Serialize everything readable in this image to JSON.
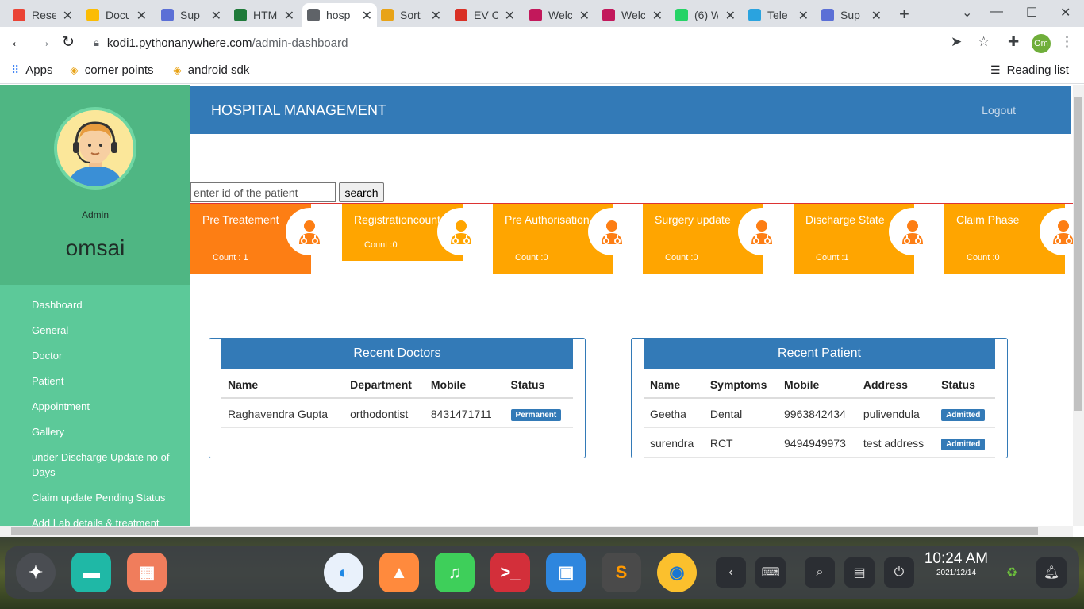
{
  "browser": {
    "tabs": [
      {
        "label": "Rese",
        "icon": "gmail-icon",
        "color": "#ea4335"
      },
      {
        "label": "Docu",
        "icon": "drive-icon",
        "color": "#fbbc04"
      },
      {
        "label": "Sup",
        "icon": "support-icon",
        "color": "#5b6fd6"
      },
      {
        "label": "HTM",
        "icon": "w-icon",
        "color": "#1f7a3a"
      },
      {
        "label": "hosp",
        "icon": "globe-icon",
        "color": "#5f6368"
      },
      {
        "label": "Sort",
        "icon": "sort-icon",
        "color": "#e8a317"
      },
      {
        "label": "EV C",
        "icon": "car-icon",
        "color": "#d93025"
      },
      {
        "label": "Welc",
        "icon": "welcome-icon",
        "color": "#c2185b"
      },
      {
        "label": "Welc",
        "icon": "welcome-icon",
        "color": "#c2185b"
      },
      {
        "label": "(6) W",
        "icon": "whatsapp-icon",
        "color": "#25d366"
      },
      {
        "label": "Tele",
        "icon": "telegram-icon",
        "color": "#2aa3df"
      },
      {
        "label": "Sup",
        "icon": "support-icon",
        "color": "#5b6fd6"
      }
    ],
    "active_tab": 4,
    "url_domain": "kodi1.pythonanywhere.com",
    "url_path": "/admin-dashboard",
    "profile_initials": "Om",
    "bookmarks": {
      "apps": "Apps",
      "items": [
        "corner points",
        "android sdk"
      ],
      "reading_list": "Reading list"
    }
  },
  "sidebar": {
    "role": "Admin",
    "username": "omsai",
    "menu": [
      "Dashboard",
      "General",
      "Doctor",
      "Patient",
      "Appointment",
      "Gallery",
      "under Discharge Update no of Days",
      "Claim update Pending Status",
      "Add Lab details & treatment"
    ]
  },
  "header": {
    "title": "HOSPITAL MANAGEMENT",
    "logout": "Logout"
  },
  "search": {
    "placeholder": "enter id of the patient",
    "button": "search"
  },
  "cards": [
    {
      "label": "Pre Treatement",
      "count": "Count : 1",
      "color": "#fd7e14"
    },
    {
      "label": "Registrationcount",
      "count": "Count :0",
      "color": "#ffa500"
    },
    {
      "label": "Pre Authorisation",
      "count": "Count :0",
      "color": "#ffa500"
    },
    {
      "label": "Surgery update",
      "count": "Count :0",
      "color": "#ffa500"
    },
    {
      "label": "Discharge State",
      "count": "Count :1",
      "color": "#ffa500"
    },
    {
      "label": "Claim Phase",
      "count": "Count :0",
      "color": "#ffa500"
    }
  ],
  "recent_doctors": {
    "title": "Recent Doctors",
    "columns": [
      "Name",
      "Department",
      "Mobile",
      "Status"
    ],
    "rows": [
      {
        "name": "Raghavendra Gupta",
        "department": "orthodontist",
        "mobile": "8431471711",
        "status": "Permanent"
      }
    ]
  },
  "recent_patients": {
    "title": "Recent Patient",
    "columns": [
      "Name",
      "Symptoms",
      "Mobile",
      "Address",
      "Status"
    ],
    "rows": [
      {
        "name": "Geetha",
        "symptoms": "Dental",
        "mobile": "9963842434",
        "address": "pulivendula",
        "status": "Admitted"
      },
      {
        "name": "surendra",
        "symptoms": "RCT",
        "mobile": "9494949973",
        "address": "test address",
        "status": "Admitted"
      }
    ]
  },
  "taskbar": {
    "time": "10:24 AM",
    "date": "2021/12/14"
  }
}
